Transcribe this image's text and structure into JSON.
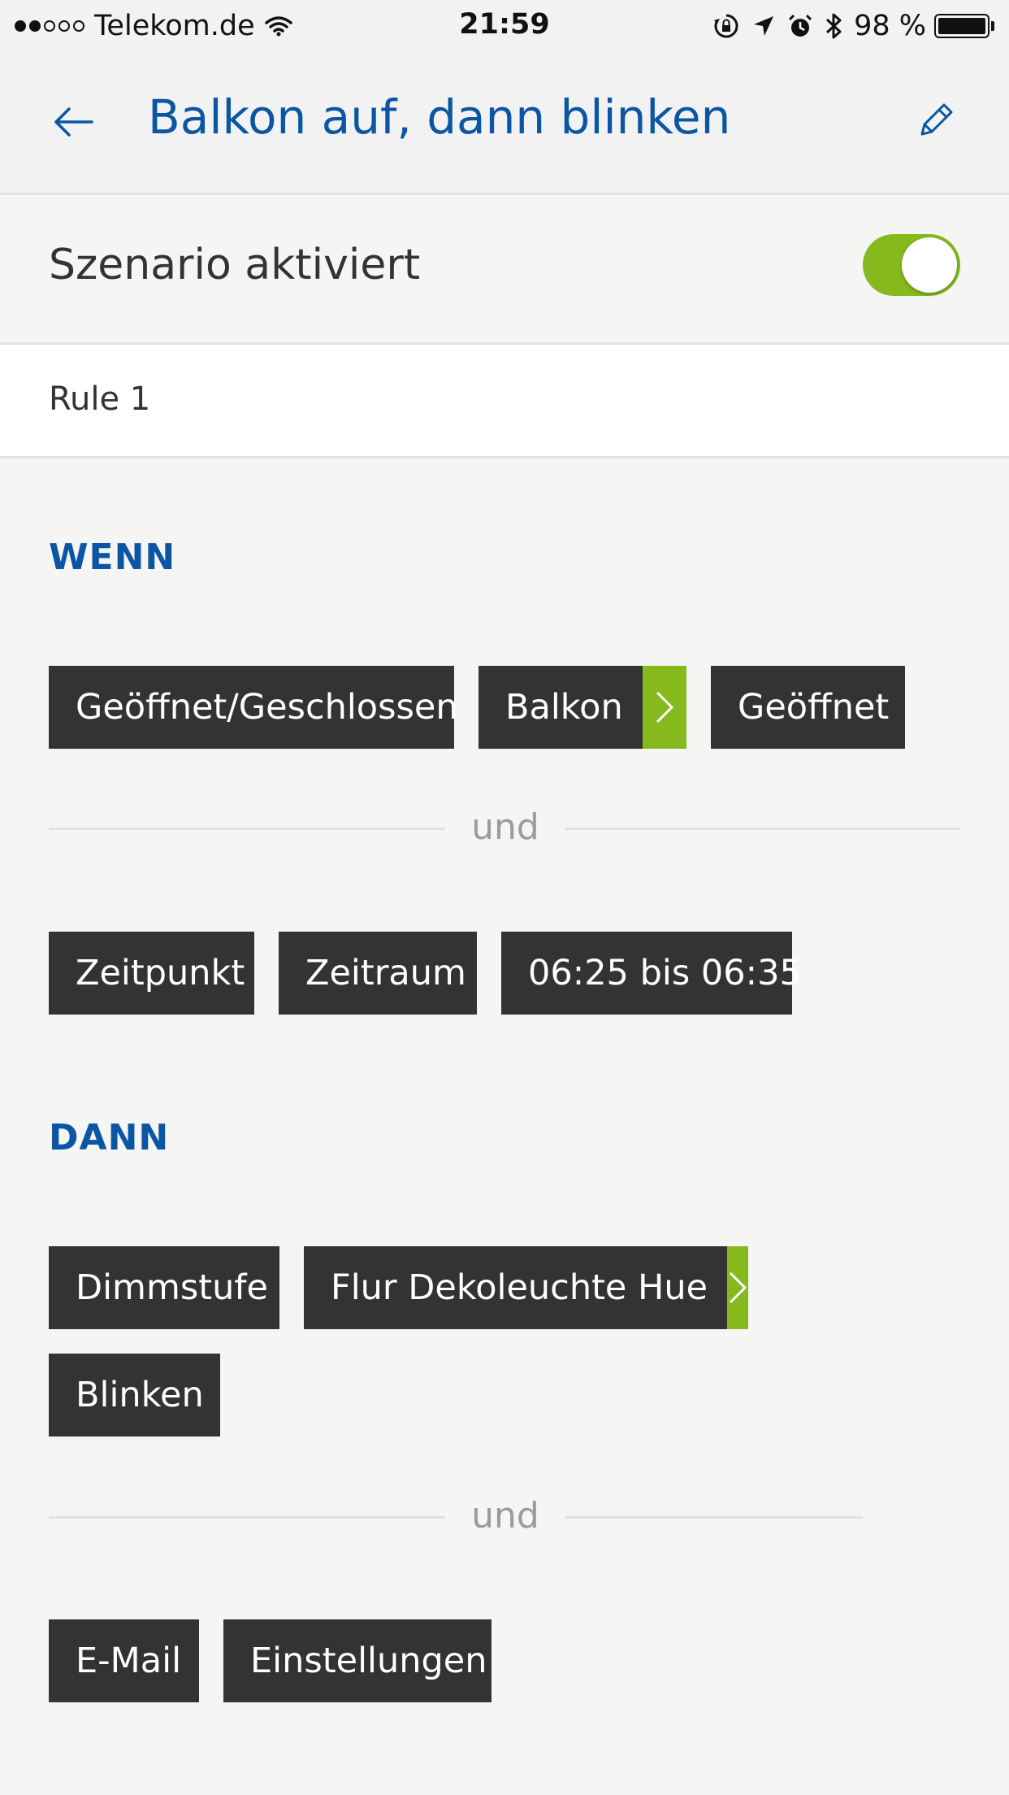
{
  "status_bar": {
    "carrier": "Telekom.de",
    "time": "21:59",
    "battery": "98 %",
    "signal_bars_filled": 2,
    "signal_bars_total": 5
  },
  "header": {
    "title": "Balkon auf, dann blinken",
    "back_icon": "arrow-left-icon",
    "edit_icon": "pencil-icon"
  },
  "activation": {
    "label": "Szenario aktiviert",
    "enabled": true
  },
  "rule": {
    "name": "Rule 1"
  },
  "wenn": {
    "title": "WENN",
    "condition1": [
      "Geöffnet/Geschlossen",
      "Balkon",
      "Geöffnet"
    ],
    "connector": "und",
    "condition2": [
      "Zeitpunkt",
      "Zeitraum",
      "06:25 bis 06:35"
    ]
  },
  "dann": {
    "title": "DANN",
    "action1": [
      "Dimmstufe",
      "Flur Dekoleuchte Hue",
      "Blinken"
    ],
    "connector": "und",
    "action2": [
      "E-Mail",
      "Einstellungen"
    ]
  },
  "colors": {
    "accent_blue": "#0b56a4",
    "accent_green": "#85b91d",
    "chip_dark": "#333333",
    "background": "#f5f5f4"
  }
}
